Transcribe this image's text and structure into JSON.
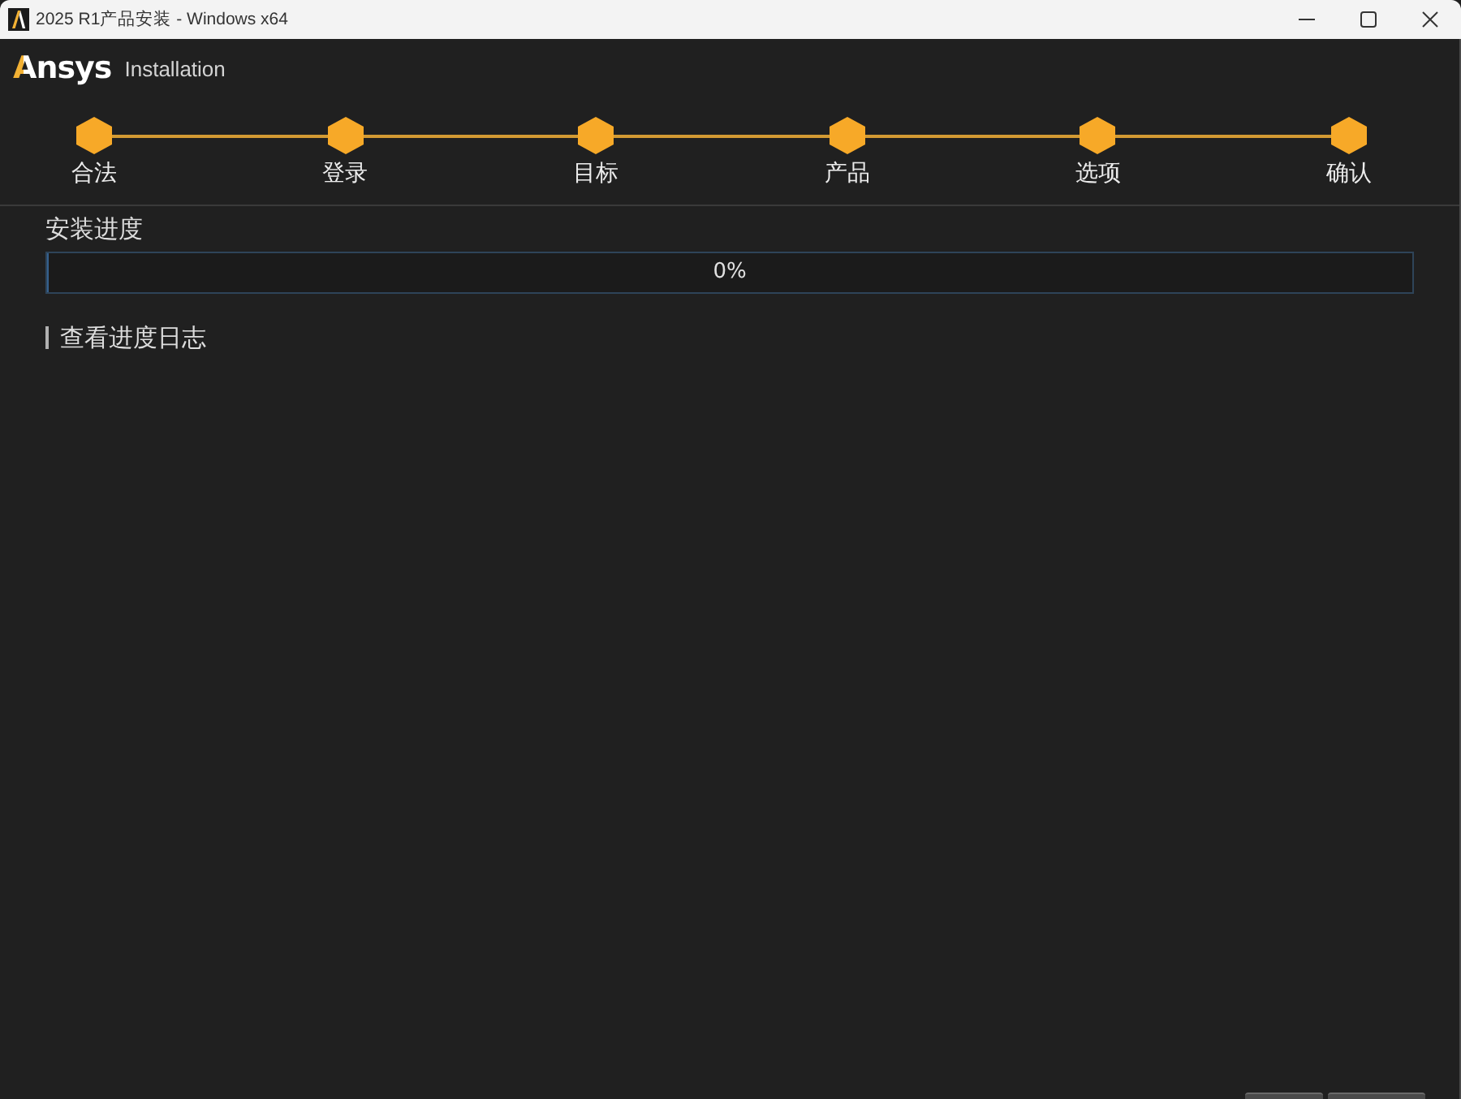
{
  "window": {
    "title": "2025 R1产品安装 - Windows x64"
  },
  "header": {
    "logo": "Ansys",
    "subtitle": "Installation"
  },
  "steps": [
    {
      "label": "合法",
      "done": true
    },
    {
      "label": "登录",
      "done": true
    },
    {
      "label": "目标",
      "done": true
    },
    {
      "label": "产品",
      "done": true
    },
    {
      "label": "选项",
      "done": true
    },
    {
      "label": "确认",
      "done": true
    }
  ],
  "progress": {
    "label": "安装进度",
    "level": 0,
    "reading": "0%"
  },
  "log_toggle": {
    "label": "查看进度日志"
  }
}
